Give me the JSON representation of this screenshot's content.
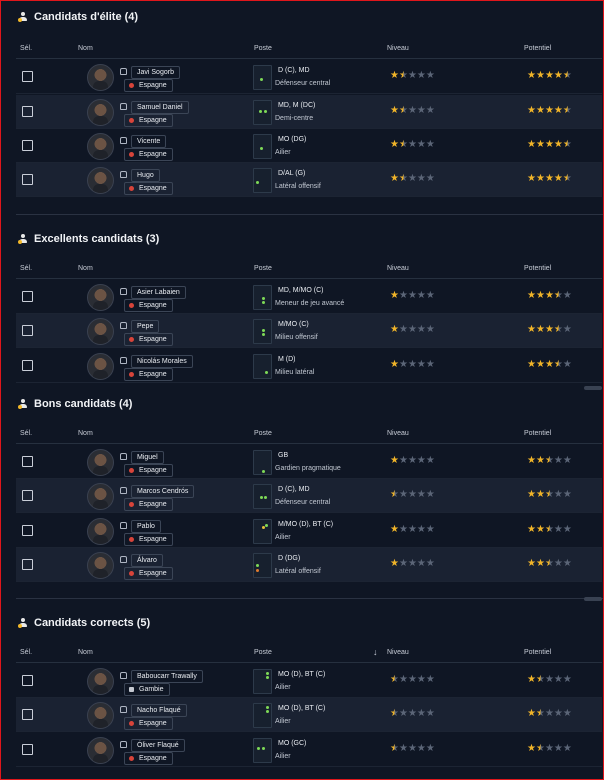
{
  "colors": {
    "accent_star": "#f0b429",
    "background": "#0f1624",
    "row_alt": "#1a2232"
  },
  "columns": {
    "select": "Sél.",
    "name": "Nom",
    "position": "Poste",
    "level": "Niveau",
    "potential": "Potentiel"
  },
  "sections": [
    {
      "title": "Candidats d'élite (4)",
      "icon": "user-star-icon",
      "players": [
        {
          "name": "Javi Sogorb",
          "nationality": "Espagne",
          "position": "D (C), MD",
          "role": "Défenseur central",
          "level": 1.5,
          "potential": 4.5
        },
        {
          "name": "Samuel Daniel",
          "nationality": "Espagne",
          "position": "MD, M (DC)",
          "role": "Demi-centre",
          "level": 1.5,
          "potential": 4.5
        },
        {
          "name": "Vicente",
          "nationality": "Espagne",
          "position": "MO (DG)",
          "role": "Ailier",
          "level": 1.5,
          "potential": 4.5
        },
        {
          "name": "Hugo",
          "nationality": "Espagne",
          "position": "D/AL (G)",
          "role": "Latéral offensif",
          "level": 1.5,
          "potential": 4.5
        }
      ]
    },
    {
      "title": "Excellents candidats (3)",
      "icon": "user-star-icon",
      "players": [
        {
          "name": "Asier Labaien",
          "nationality": "Espagne",
          "position": "MD, M/MO (C)",
          "role": "Meneur de jeu avancé",
          "level": 1,
          "potential": 3.5
        },
        {
          "name": "Pepe",
          "nationality": "Espagne",
          "position": "M/MO (C)",
          "role": "Milieu offensif",
          "level": 1,
          "potential": 3.5
        },
        {
          "name": "Nicolás Morales",
          "nationality": "Espagne",
          "position": "M (D)",
          "role": "Milieu latéral",
          "level": 1,
          "potential": 3.5
        }
      ]
    },
    {
      "title": "Bons candidats (4)",
      "icon": "user-star-icon",
      "players": [
        {
          "name": "Miguel",
          "nationality": "Espagne",
          "position": "GB",
          "role": "Gardien pragmatique",
          "level": 1,
          "potential": 2.5
        },
        {
          "name": "Marcos Cendrós",
          "nationality": "Espagne",
          "position": "D (C), MD",
          "role": "Défenseur central",
          "level": 0.5,
          "potential": 2.5
        },
        {
          "name": "Pablo",
          "nationality": "Espagne",
          "position": "M/MO (D), BT (C)",
          "role": "Ailier",
          "level": 1,
          "potential": 2.5
        },
        {
          "name": "Álvaro",
          "nationality": "Espagne",
          "position": "D (DG)",
          "role": "Latéral offensif",
          "level": 1,
          "potential": 2.5
        }
      ]
    },
    {
      "title": "Candidats corrects (5)",
      "icon": "user-star-icon",
      "players": [
        {
          "name": "Baboucarr Trawally",
          "nationality": "Gambie",
          "position": "MO (D), BT (C)",
          "role": "Ailier",
          "level": 0.5,
          "potential": 1.5
        },
        {
          "name": "Nacho Flaqué",
          "nationality": "Espagne",
          "position": "MO (D), BT (C)",
          "role": "Ailier",
          "level": 0.5,
          "potential": 1.5
        },
        {
          "name": "Óliver Flaqué",
          "nationality": "Espagne",
          "position": "MO (GC)",
          "role": "Ailier",
          "level": 0.5,
          "potential": 1.5
        }
      ]
    }
  ]
}
